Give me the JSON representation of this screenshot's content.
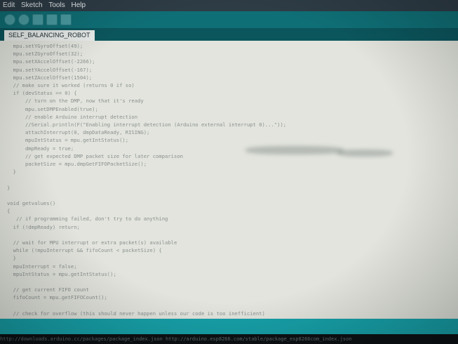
{
  "menu": {
    "items": [
      "Edit",
      "Sketch",
      "Tools",
      "Help"
    ]
  },
  "tab": {
    "name": "SELF_BALANCING_ROBOT"
  },
  "code_lines": [
    "  mpu.setYGyroOffset(49);",
    "  mpu.setZGyroOffset(32);",
    "  mpu.setXAccelOffset(-2266);",
    "  mpu.setYAccelOffset(-167);",
    "  mpu.setZAccelOffset(1504);",
    "  // make sure it worked (returns 0 if so)",
    "  if (devStatus == 0) {",
    "      // turn on the DMP, now that it's ready",
    "      mpu.setDMPEnabled(true);",
    "      // enable Arduino interrupt detection",
    "      //Serial.println(F(\"Enabling interrupt detection (Arduino external interrupt 0)...\"));",
    "      attachInterrupt(0, dmpDataReady, RISING);",
    "      mpuIntStatus = mpu.getIntStatus();",
    "      dmpReady = true;",
    "      // get expected DMP packet size for later comparison",
    "      packetSize = mpu.dmpGetFIFOPacketSize();",
    "  }",
    "",
    "}",
    "",
    "void getvalues()",
    "{",
    "   // if programming failed, don't try to do anything",
    "  if (!dmpReady) return;",
    "",
    "  // wait for MPU interrupt or extra packet(s) available",
    "  while (!mpuInterrupt && fifoCount < packetSize) {",
    "  }",
    "  mpuInterrupt = false;",
    "  mpuIntStatus = mpu.getIntStatus();",
    "",
    "  // get current FIFO count",
    "  fifoCount = mpu.getFIFOCount();",
    "",
    "  // check for overflow (this should never happen unless our code is too inefficient)"
  ],
  "console": {
    "text": "http://downloads.arduino.cc/packages/package_index.json http://arduino.esp8266.com/stable/package_esp8266com_index.json"
  },
  "colors": {
    "toolbar": "#0f6f76",
    "statusbar": "#17a0a8",
    "editor_bg": "#e2e4dd"
  }
}
